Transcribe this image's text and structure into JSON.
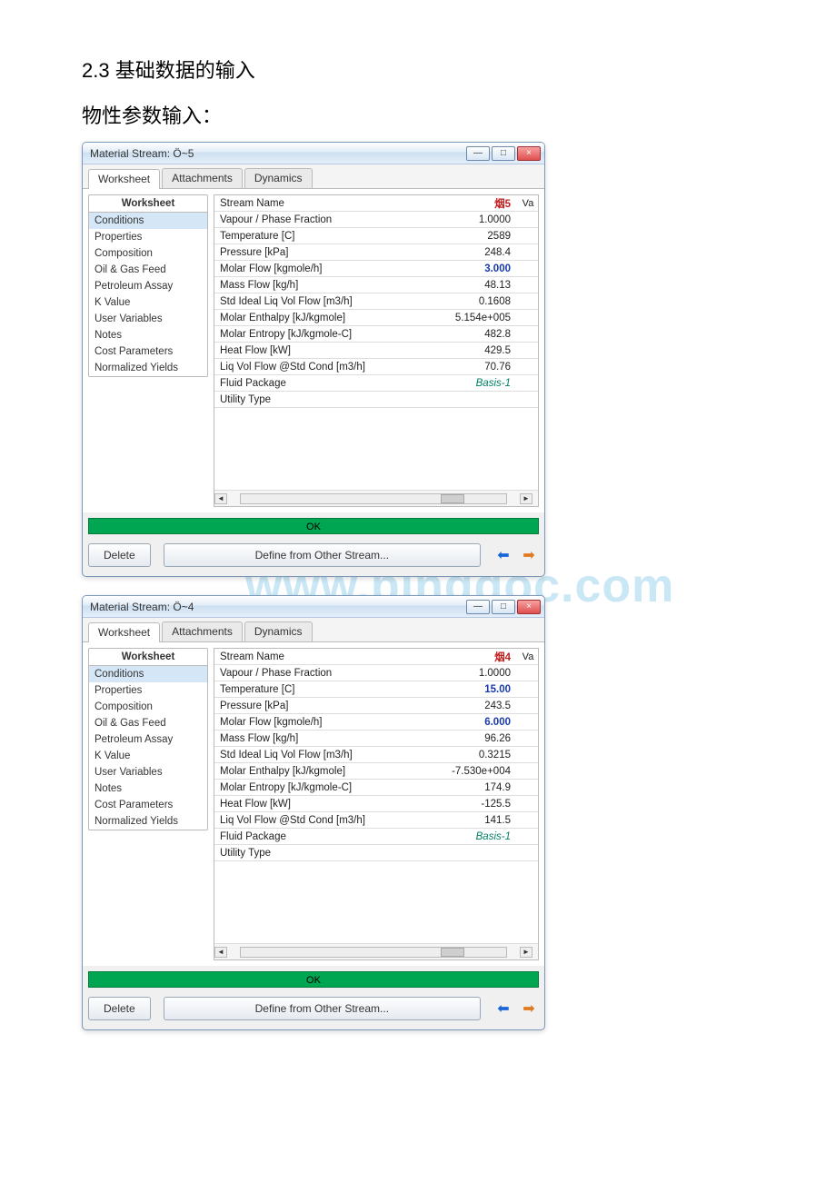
{
  "headings": {
    "h1": "2.3 基础数据的输入",
    "h2": "物性参数输入："
  },
  "watermark": "www.bingdoc.com",
  "winctl": {
    "min": "—",
    "max": "□",
    "close": "×"
  },
  "common": {
    "tabs": [
      "Worksheet",
      "Attachments",
      "Dynamics"
    ],
    "sidepanel_title": "Worksheet",
    "side_items": [
      "Conditions",
      "Properties",
      "Composition",
      "Oil & Gas Feed",
      "Petroleum Assay",
      "K Value",
      "User Variables",
      "Notes",
      "Cost Parameters",
      "Normalized Yields"
    ],
    "okbar": "OK",
    "delete_btn": "Delete",
    "define_btn": "Define from Other Stream...",
    "col2_head": "Va",
    "sb_left": "◄",
    "sb_right": "►",
    "nav_left": "⬅",
    "nav_right": "➡"
  },
  "win1": {
    "title": "Material Stream: Ö~5",
    "header_value": "烟5",
    "rows": [
      {
        "k": "Stream Name",
        "v": "烟5",
        "type": "header"
      },
      {
        "k": "Vapour / Phase Fraction",
        "v": "1.0000",
        "type": ""
      },
      {
        "k": "Temperature [C]",
        "v": "2589",
        "type": ""
      },
      {
        "k": "Pressure [kPa]",
        "v": "248.4",
        "type": ""
      },
      {
        "k": "Molar Flow [kgmole/h]",
        "v": "3.000",
        "type": "blue"
      },
      {
        "k": "Mass Flow [kg/h]",
        "v": "48.13",
        "type": ""
      },
      {
        "k": "Std Ideal Liq Vol Flow [m3/h]",
        "v": "0.1608",
        "type": ""
      },
      {
        "k": "Molar Enthalpy [kJ/kgmole]",
        "v": "5.154e+005",
        "type": ""
      },
      {
        "k": "Molar Entropy [kJ/kgmole-C]",
        "v": "482.8",
        "type": ""
      },
      {
        "k": "Heat Flow [kW]",
        "v": "429.5",
        "type": ""
      },
      {
        "k": "Liq Vol Flow @Std Cond [m3/h]",
        "v": "70.76",
        "type": ""
      },
      {
        "k": "Fluid Package",
        "v": "Basis-1",
        "type": "teal"
      },
      {
        "k": "Utility Type",
        "v": "",
        "type": ""
      }
    ]
  },
  "win2": {
    "title": "Material Stream: Ö~4",
    "header_value": "烟4",
    "rows": [
      {
        "k": "Stream Name",
        "v": "烟4",
        "type": "header"
      },
      {
        "k": "Vapour / Phase Fraction",
        "v": "1.0000",
        "type": ""
      },
      {
        "k": "Temperature [C]",
        "v": "15.00",
        "type": "blue"
      },
      {
        "k": "Pressure [kPa]",
        "v": "243.5",
        "type": ""
      },
      {
        "k": "Molar Flow [kgmole/h]",
        "v": "6.000",
        "type": "blue"
      },
      {
        "k": "Mass Flow [kg/h]",
        "v": "96.26",
        "type": ""
      },
      {
        "k": "Std Ideal Liq Vol Flow [m3/h]",
        "v": "0.3215",
        "type": ""
      },
      {
        "k": "Molar Enthalpy [kJ/kgmole]",
        "v": "-7.530e+004",
        "type": ""
      },
      {
        "k": "Molar Entropy [kJ/kgmole-C]",
        "v": "174.9",
        "type": ""
      },
      {
        "k": "Heat Flow [kW]",
        "v": "-125.5",
        "type": ""
      },
      {
        "k": "Liq Vol Flow @Std Cond [m3/h]",
        "v": "141.5",
        "type": ""
      },
      {
        "k": "Fluid Package",
        "v": "Basis-1",
        "type": "teal"
      },
      {
        "k": "Utility Type",
        "v": "",
        "type": ""
      }
    ]
  }
}
